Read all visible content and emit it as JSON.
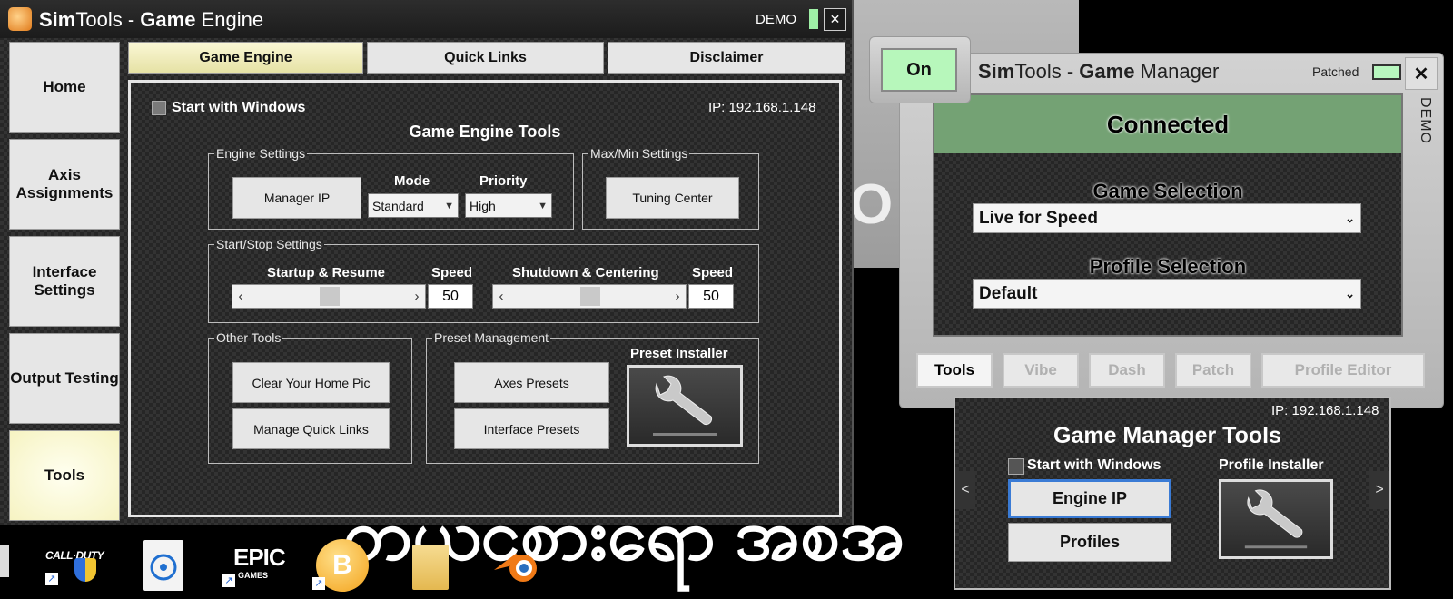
{
  "engine": {
    "title_sim": "Sim",
    "title_tools": "Tools",
    "title_sep": " - ",
    "title_game": "Game",
    "title_engine": " Engine",
    "demo_label": "DEMO",
    "close_label": "✕",
    "sidebar": [
      {
        "label": "Home"
      },
      {
        "label": "Axis Assignments"
      },
      {
        "label": "Interface Settings"
      },
      {
        "label": "Output Testing"
      },
      {
        "label": "Tools"
      }
    ],
    "tabs": [
      {
        "label": "Game Engine"
      },
      {
        "label": "Quick Links"
      },
      {
        "label": "Disclaimer"
      }
    ],
    "start_with_windows": "Start with Windows",
    "ip": "IP: 192.168.1.148",
    "tools_title": "Game Engine Tools",
    "engine_settings": {
      "legend": "Engine Settings",
      "manager_ip": "Manager IP",
      "mode_label": "Mode",
      "mode_value": "Standard",
      "priority_label": "Priority",
      "priority_value": "High"
    },
    "maxmin": {
      "legend": "Max/Min Settings",
      "tuning": "Tuning Center"
    },
    "startstop": {
      "legend": "Start/Stop Settings",
      "startup_label": "Startup & Resume",
      "speed_label": "Speed",
      "startup_speed": "50",
      "shutdown_label": "Shutdown & Centering",
      "shutdown_speed": "50"
    },
    "other_tools": {
      "legend": "Other Tools",
      "clear_pic": "Clear Your Home Pic",
      "manage_links": "Manage Quick Links"
    },
    "preset": {
      "legend": "Preset Management",
      "axes": "Axes Presets",
      "interface": "Interface Presets",
      "installer_label": "Preset Installer"
    }
  },
  "manager": {
    "on_label": "On",
    "title_sim": "Sim",
    "title_tools": "Tools",
    "title_sep": " - ",
    "title_game": "Game",
    "title_manager": " Manager",
    "patched_label": "Patched",
    "close_label": "✕",
    "demo_vertical": "DEMO",
    "status": "Connected",
    "game_selection_label": "Game Selection",
    "game_selection_value": "Live for Speed",
    "profile_selection_label": "Profile Selection",
    "profile_selection_value": "Default",
    "tabs": [
      {
        "label": "Tools"
      },
      {
        "label": "Vibe"
      },
      {
        "label": "Dash"
      },
      {
        "label": "Patch"
      },
      {
        "label": "Profile Editor"
      }
    ],
    "ip": "IP: 192.168.1.148",
    "tools_title": "Game Manager Tools",
    "start_with_windows": "Start with Windows",
    "profile_installer_label": "Profile Installer",
    "engine_ip": "Engine IP",
    "profiles": "Profiles",
    "nav_prev": "<",
    "nav_next": ">"
  },
  "taskbar": {
    "icons": [
      "call-of-duty-icon",
      "document-icon",
      "epic-games-icon",
      "bitcoin-icon",
      "folder-icon",
      "blender-icon"
    ],
    "cod_text": "CALL·DUTY",
    "epic_text": "EPIC",
    "epic_sub": "GAMES",
    "btc_text": "B"
  },
  "background": {
    "wallpaper_text": "တယ်ငစားရော အစီအ"
  }
}
